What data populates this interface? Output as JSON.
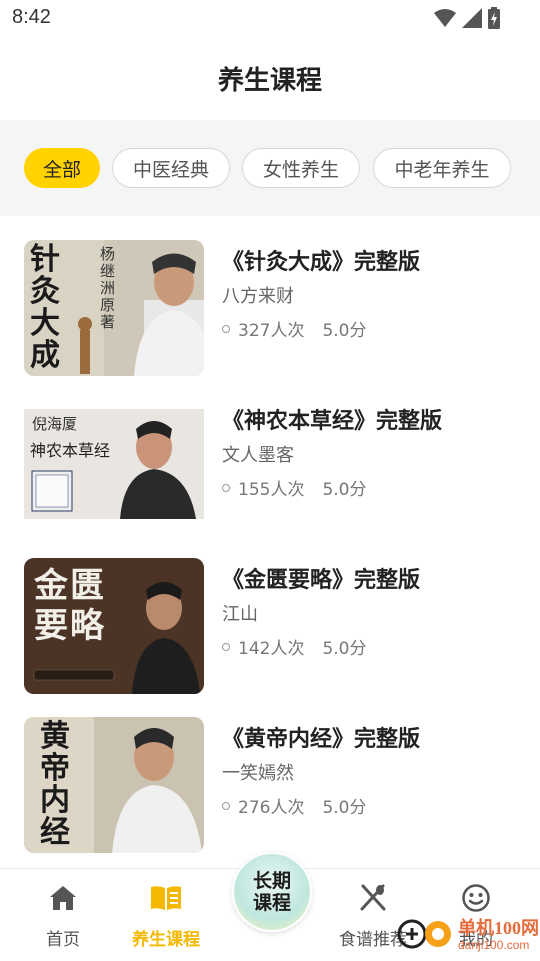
{
  "status_bar": {
    "time": "8:42"
  },
  "header": {
    "title": "养生课程"
  },
  "filters": {
    "chips": [
      {
        "label": "全部",
        "active": true
      },
      {
        "label": "中医经典",
        "active": false
      },
      {
        "label": "女性养生",
        "active": false
      },
      {
        "label": "中老年养生",
        "active": false
      }
    ]
  },
  "courses": [
    {
      "title": "《针灸大成》完整版",
      "author": "八方来财",
      "views": "327人次",
      "rating": "5.0分",
      "cover_text": "针灸大成",
      "cover_caption": "杨继洲原著"
    },
    {
      "title": "《神农本草经》完整版",
      "author": "文人墨客",
      "views": "155人次",
      "rating": "5.0分",
      "cover_text": "神农本草经",
      "cover_caption": "倪海厦"
    },
    {
      "title": "《金匮要略》完整版",
      "author": "江山",
      "views": "142人次",
      "rating": "5.0分",
      "cover_text": "金匮要略",
      "cover_caption": ""
    },
    {
      "title": "《黄帝内经》完整版",
      "author": "一笑嫣然",
      "views": "276人次",
      "rating": "5.0分",
      "cover_text": "黄帝内经",
      "cover_caption": ""
    }
  ],
  "tabbar": {
    "home": "首页",
    "courses": "养生课程",
    "center": "长期课程",
    "recipes": "食谱推荐",
    "mine": "我的"
  },
  "watermark": {
    "line1": "单机100网",
    "line2": "danji100.com"
  },
  "colors": {
    "accent": "#ffd200",
    "active_tab": "#f4b800"
  }
}
